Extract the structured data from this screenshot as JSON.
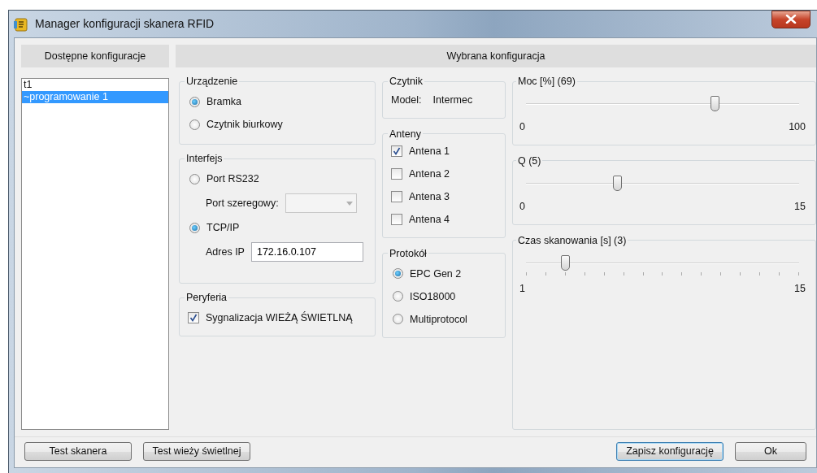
{
  "window": {
    "title": "Manager konfiguracji skanera RFID"
  },
  "left_panel": {
    "header": "Dostępne konfiguracje",
    "items": [
      {
        "label": "t1",
        "selected": false
      },
      {
        "label": "~programowanie 1",
        "selected": true
      }
    ]
  },
  "right_panel": {
    "header": "Wybrana konfiguracja",
    "device": {
      "title": "Urządzenie",
      "options": [
        {
          "label": "Bramka",
          "selected": true
        },
        {
          "label": "Czytnik biurkowy",
          "selected": false
        }
      ]
    },
    "interface": {
      "title": "Interfejs",
      "items": [
        {
          "kind": "radio",
          "label": "Port RS232",
          "selected": false
        },
        {
          "kind": "select",
          "label": "Port szeregowy:",
          "disabled": true
        },
        {
          "kind": "radio",
          "label": "TCP/IP",
          "selected": true
        },
        {
          "kind": "text",
          "label": "Adres IP",
          "value": "172.16.0.107"
        }
      ]
    },
    "peripherals": {
      "title": "Peryferia",
      "items": [
        {
          "label": "Sygnalizacja WIEŻĄ ŚWIETLNĄ",
          "checked": true
        }
      ]
    },
    "reader": {
      "title": "Czytnik",
      "model_label": "Model:",
      "model_value": "Intermec"
    },
    "antennas": {
      "title": "Anteny",
      "items": [
        {
          "label": "Antena 1",
          "checked": true
        },
        {
          "label": "Antena 2",
          "checked": false
        },
        {
          "label": "Antena 3",
          "checked": false
        },
        {
          "label": "Antena 4",
          "checked": false
        }
      ]
    },
    "protocol": {
      "title": "Protokół",
      "options": [
        {
          "label": "EPC Gen 2",
          "selected": true
        },
        {
          "label": "ISO18000",
          "selected": false
        },
        {
          "label": "Multiprotocol",
          "selected": false
        }
      ]
    },
    "sliders": [
      {
        "title": "Moc [%] (69)",
        "level": 0.69,
        "min_label": "0",
        "max_label": "100",
        "ticks": false
      },
      {
        "title": "Q (5)",
        "level": 0.333,
        "min_label": "0",
        "max_label": "15",
        "ticks": false
      },
      {
        "title": "Czas skanowania [s] (3)",
        "level": 0.143,
        "min_label": "1",
        "max_label": "15",
        "ticks": true
      }
    ]
  },
  "buttons": {
    "left": [
      {
        "label": "Test skanera",
        "focused": false
      },
      {
        "label": "Test wieży świetlnej",
        "focused": false
      }
    ],
    "right": [
      {
        "label": "Zapisz konfigurację",
        "focused": true
      },
      {
        "label": "Ok",
        "focused": false
      }
    ]
  }
}
